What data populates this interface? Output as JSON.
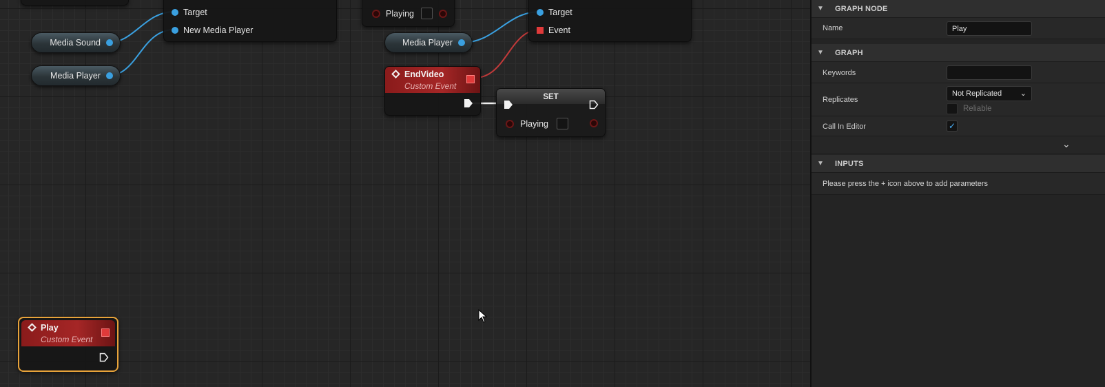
{
  "graph": {
    "nodes": {
      "top_left": {
        "pins": [
          "Target",
          "New Media Player"
        ]
      },
      "top_mid": {
        "playing_label": "Playing"
      },
      "top_right": {
        "pins": [
          "Target",
          "Event"
        ]
      },
      "var_media_sound": "Media Sound",
      "var_media_player_left": "Media Player",
      "var_media_player_right": "Media Player",
      "end_video": {
        "title": "EndVideo",
        "subtitle": "Custom Event"
      },
      "set_node": {
        "title": "SET",
        "playing_label": "Playing"
      },
      "play_event": {
        "title": "Play",
        "subtitle": "Custom Event"
      }
    },
    "colors": {
      "object_pin": "#3aa0e0",
      "event_header": "#a52626",
      "delegate_pin": "#e03a3a",
      "selection": "#e8a33a"
    }
  },
  "panel": {
    "graph_node": {
      "header": "GRAPH NODE",
      "name_label": "Name",
      "name_value": "Play"
    },
    "graph": {
      "header": "GRAPH",
      "keywords_label": "Keywords",
      "keywords_value": "",
      "replicates_label": "Replicates",
      "replicates_value": "Not Replicated",
      "reliable_label": "Reliable",
      "call_in_editor_label": "Call In Editor",
      "call_in_editor_checked": true
    },
    "inputs": {
      "header": "INPUTS",
      "hint": "Please press the + icon above to add parameters"
    }
  }
}
